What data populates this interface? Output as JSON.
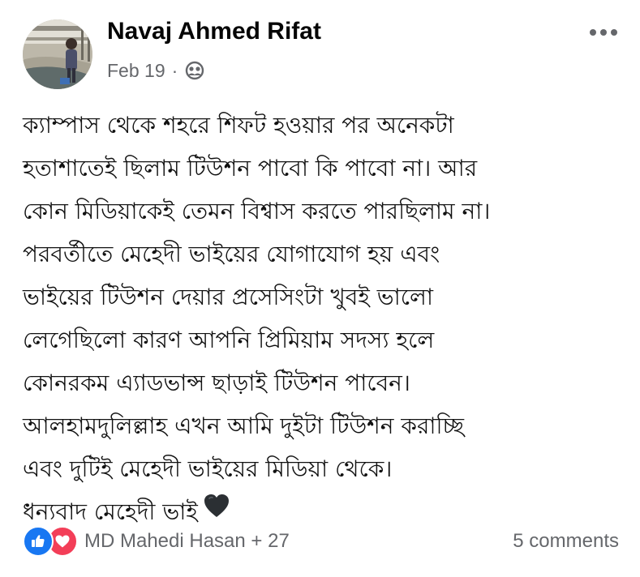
{
  "post": {
    "author": "Navaj Ahmed Rifat",
    "date": "Feb 19",
    "separator": "·",
    "audience_icon": "friends-icon",
    "more_icon": "more-options-icon",
    "body_lines": [
      "ক্যাম্পাস থেকে শহরে শিফট হওয়ার পর অনেকটা",
      "হতাশাতেই ছিলাম টিউশন পাবো কি পাবো না। আর",
      "কোন মিডিয়াকেই তেমন বিশ্বাস করতে পারছিলাম না।",
      "পরবর্তীতে মেহেদী ভাইয়ের যোগাযোগ হয় এবং",
      "ভাইয়ের টিউশন দেয়ার প্রসেসিংটা খুবই ভালো",
      "লেগেছিলো কারণ আপনি প্রিমিয়াম সদস্য হলে",
      "কোনরকম এ্যাডভান্স ছাড়াই টিউশন পাবেন।",
      "আলহামদুলিল্লাহ এখন আমি দুইটা টিউশন করাচ্ছি",
      "এবং দুটিই মেহেদী ভাইয়ের মিডিয়া থেকে।",
      "ধন্যবাদ মেহেদী ভাই"
    ],
    "emoji_icon": "black-heart-emoji"
  },
  "reactions": {
    "icons": [
      "like-icon",
      "love-icon"
    ],
    "summary": "MD Mahedi Hasan + 27",
    "colors": {
      "like": "#1877f2",
      "love": "#f33e58"
    }
  },
  "comments": {
    "label": "5 comments"
  },
  "colors": {
    "name_text": "#050505",
    "secondary_text": "#65676b",
    "background": "#ffffff"
  }
}
